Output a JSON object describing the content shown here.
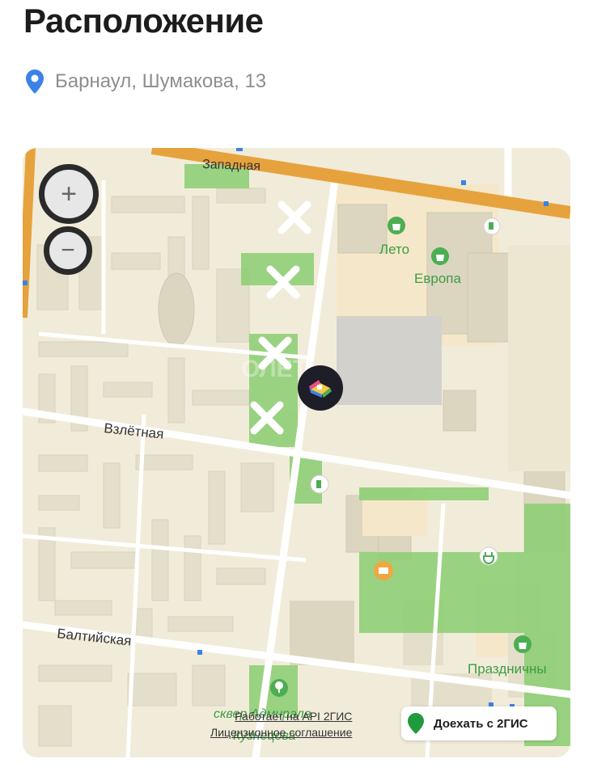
{
  "title": "Расположение",
  "address": "Барнаул, Шумакова, 13",
  "map": {
    "streets": {
      "zapadnaya": "Западная",
      "vzletnaya": "Взлётная",
      "baltiyskaya": "Балтийская"
    },
    "pois": {
      "leto": "Лето",
      "evropa": "Европа",
      "prazdnichny": "Праздничны",
      "skver_line1": "сквер Адмирала",
      "skver_line2": "Кузнецова"
    },
    "watermark_text": "ОЛЕТ",
    "footer": {
      "api_text": "Работает на API 2ГИС",
      "license_text": "Лицензионное соглашение"
    },
    "route_button": "Доехать с 2ГИС",
    "zoom_in_symbol": "+",
    "zoom_out_symbol": "−"
  },
  "colors": {
    "pin": "#3b82e6",
    "highway": "#e6a23c",
    "park": "#8fcf76",
    "map_bg": "#f1ecda",
    "poi_green": "#4cae52"
  }
}
